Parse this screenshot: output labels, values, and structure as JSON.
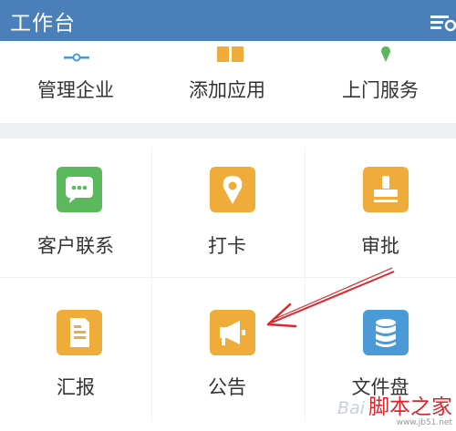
{
  "header": {
    "title": "工作台",
    "menu_icon": "list-settings-icon"
  },
  "top_row": [
    {
      "label": "管理企业",
      "icon": "key-icon"
    },
    {
      "label": "添加应用",
      "icon": "grid-icon"
    },
    {
      "label": "上门服务",
      "icon": "location-pin-icon"
    }
  ],
  "apps": [
    {
      "label": "客户联系",
      "icon": "chat-bubble-icon",
      "color": "#5cb85c"
    },
    {
      "label": "打卡",
      "icon": "location-pin-icon",
      "color": "#f0ac3a"
    },
    {
      "label": "审批",
      "icon": "stamp-icon",
      "color": "#f0ac3a"
    },
    {
      "label": "汇报",
      "icon": "document-icon",
      "color": "#f0ac3a"
    },
    {
      "label": "公告",
      "icon": "megaphone-icon",
      "color": "#f0ac3a"
    },
    {
      "label": "文件盘",
      "icon": "database-icon",
      "color": "#4a9ad8"
    }
  ],
  "annotation": {
    "arrow_color": "#e0262b"
  },
  "watermark": {
    "baidu": "Bai",
    "site": "脚本之家",
    "url": "www.jb51.net"
  }
}
